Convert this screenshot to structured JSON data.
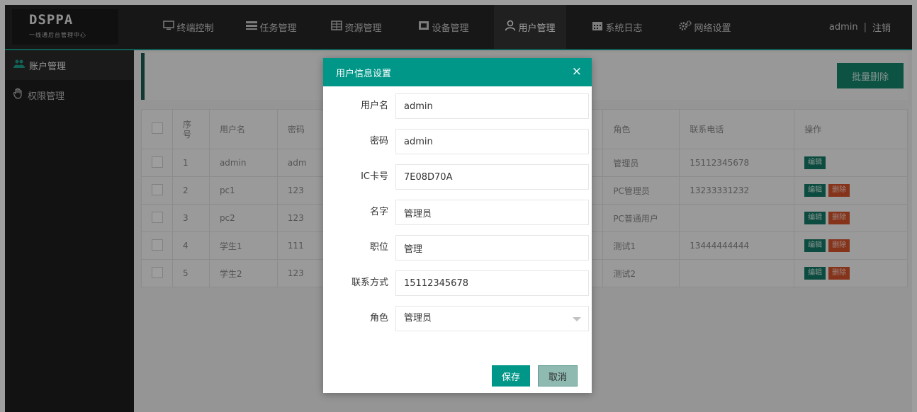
{
  "logo": {
    "main": "DSPPA",
    "sub": "一线通后台管理中心"
  },
  "nav": {
    "items": [
      {
        "label": "终端控制",
        "icon": "monitor-icon"
      },
      {
        "label": "任务管理",
        "icon": "task-icon"
      },
      {
        "label": "资源管理",
        "icon": "grid-icon"
      },
      {
        "label": "设备管理",
        "icon": "device-icon"
      },
      {
        "label": "用户管理",
        "icon": "user-icon"
      },
      {
        "label": "系统日志",
        "icon": "calendar-icon"
      },
      {
        "label": "网络设置",
        "icon": "gear-icon"
      }
    ],
    "active": "用户管理",
    "user": "admin",
    "separator": "|",
    "logout": "注销"
  },
  "sidebar": {
    "items": [
      {
        "label": "账户管理",
        "icon": "users-icon"
      },
      {
        "label": "权限管理",
        "icon": "hand-icon"
      }
    ]
  },
  "toolbar": {
    "batch_delete": "批量删除"
  },
  "table": {
    "headers": {
      "no": "序号",
      "username": "用户名",
      "password": "密码",
      "role": "角色",
      "phone": "联系电话",
      "actions": "操作"
    },
    "edit_label": "编辑",
    "delete_label": "删除",
    "rows": [
      {
        "no": "1",
        "username": "admin",
        "password": "adm",
        "role": "管理员",
        "phone": "15112345678"
      },
      {
        "no": "2",
        "username": "pc1",
        "password": "123",
        "role": "PC管理员",
        "phone": "13233331232"
      },
      {
        "no": "3",
        "username": "pc2",
        "password": "123",
        "role": "PC普通用户",
        "phone": ""
      },
      {
        "no": "4",
        "username": "学生1",
        "password": "111",
        "role": "测试1",
        "phone": "13444444444"
      },
      {
        "no": "5",
        "username": "学生2",
        "password": "123",
        "role": "测试2",
        "phone": ""
      }
    ]
  },
  "colors": {
    "accent": "#009688",
    "danger": "#d9532c",
    "nav_bg": "#262626"
  },
  "modal": {
    "title": "用户信息设置",
    "close": "×",
    "fields": {
      "username": {
        "label": "用户名",
        "value": "admin"
      },
      "password": {
        "label": "密码",
        "value": "admin"
      },
      "ic_card": {
        "label": "IC卡号",
        "value": "7E08D70A"
      },
      "name": {
        "label": "名字",
        "value": "管理员"
      },
      "position": {
        "label": "职位",
        "value": "管理"
      },
      "contact": {
        "label": "联系方式",
        "value": "15112345678"
      },
      "role": {
        "label": "角色",
        "value": "管理员"
      }
    },
    "save": "保存",
    "cancel": "取消"
  }
}
